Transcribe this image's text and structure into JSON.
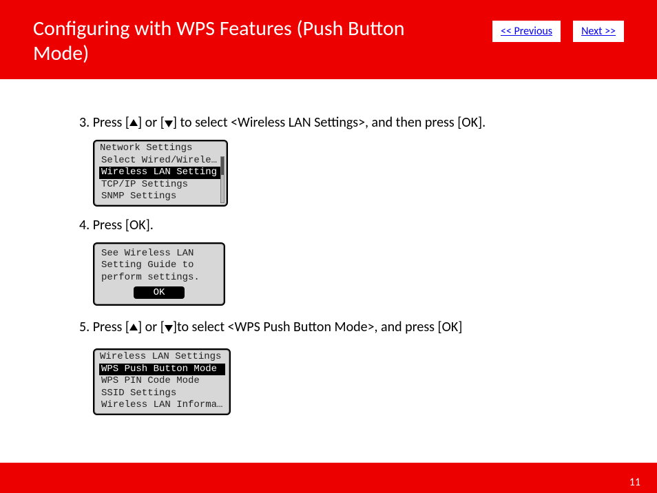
{
  "header": {
    "title": "Configuring with WPS Features (Push Button Mode)",
    "prev": "<< Previous",
    "next": "Next >>"
  },
  "steps": {
    "s3": {
      "num": "3.",
      "pre": "Press [",
      "mid1": "] or [",
      "mid2": "] to select <Wireless LAN Settings>, and then press [OK]."
    },
    "s4": {
      "text": "4. Press [OK]."
    },
    "s5": {
      "num": "5.",
      "pre": "Press [",
      "mid1": "] or [",
      "mid2": "]to select <WPS Push Button Mode>, and press [OK]"
    }
  },
  "lcd1": {
    "title": "Network Settings",
    "items": [
      {
        "label": "Select Wired/Wirele…",
        "selected": false
      },
      {
        "label": "Wireless LAN Setting",
        "selected": true
      },
      {
        "label": "TCP/IP Settings",
        "selected": false
      },
      {
        "label": "SNMP Settings",
        "selected": false
      }
    ]
  },
  "lcd_msg": {
    "line1": "See Wireless LAN",
    "line2": "Setting Guide to",
    "line3": "perform settings.",
    "ok": "OK"
  },
  "lcd3": {
    "title": "Wireless LAN Settings",
    "items": [
      {
        "label": "WPS Push Button Mode",
        "selected": true
      },
      {
        "label": "WPS PIN Code Mode",
        "selected": false
      },
      {
        "label": "SSID Settings",
        "selected": false
      },
      {
        "label": "Wireless LAN Informa…",
        "selected": false
      }
    ]
  },
  "page_number": "11"
}
